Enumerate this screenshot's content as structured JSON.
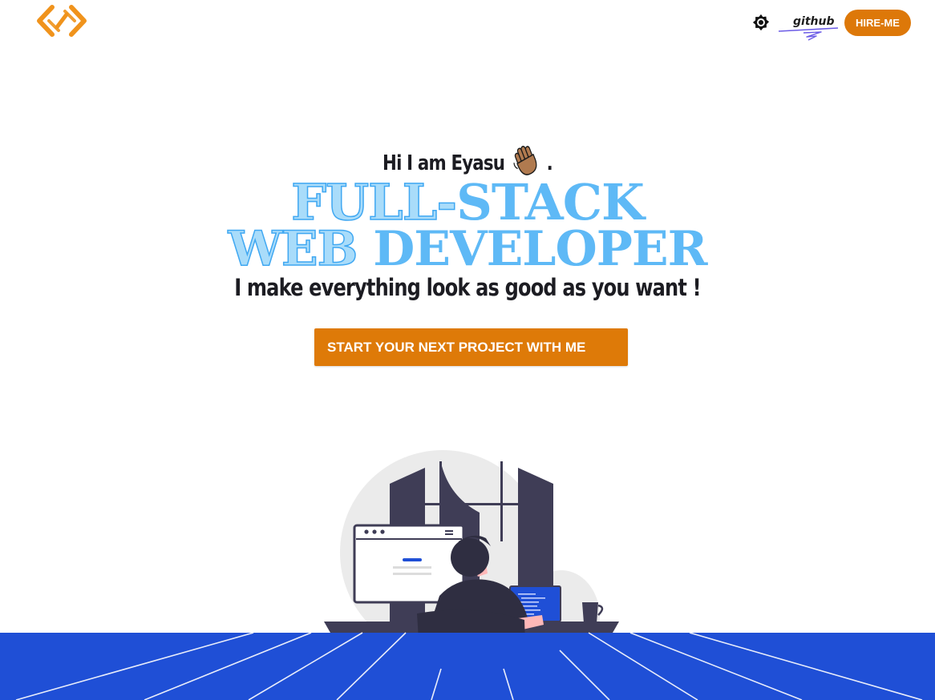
{
  "header": {
    "logo": {
      "icon": "code-brackets-logo",
      "color": "#f0931c"
    },
    "theme_toggle": {
      "icon": "brightness-icon"
    },
    "github_label": "github",
    "hire_label": "HIRE-ME"
  },
  "hero": {
    "greeting": "Hi I am Eyasu",
    "greeting_emoji": "waving-hand-icon",
    "greeting_suffix": ".",
    "title_line1_outline": "FULL-",
    "title_line1_solid": "STACK",
    "title_line2_outline": "WEB ",
    "title_line2_solid": "DEVELOPER",
    "tagline": "I make everything look as good as you want !",
    "cta_label": "START YOUR NEXT PROJECT WITH ME"
  },
  "colors": {
    "accent_orange": "#dd7809",
    "title_blue": "#5eb9f6",
    "title_outline_fill": "#a9dcfa",
    "floor_blue": "#1f4fd6",
    "scribble_purple": "#7b6cf0"
  }
}
